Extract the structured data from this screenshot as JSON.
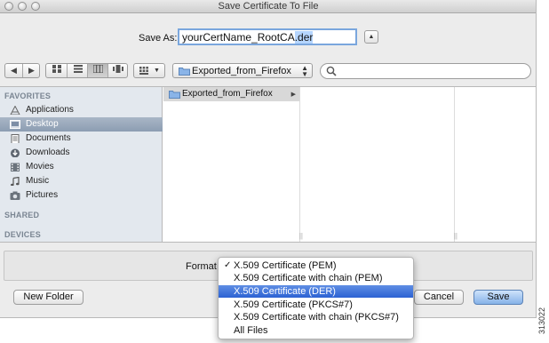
{
  "window": {
    "title": "Save Certificate To File"
  },
  "save_as": {
    "label": "Save As:",
    "filename_base": "yourCertName_RootCA",
    "filename_ext": ".der"
  },
  "location": {
    "current_folder": "Exported_from_Firefox",
    "search_value": ""
  },
  "sidebar": {
    "favorites_header": "FAVORITES",
    "items": [
      {
        "label": "Applications",
        "icon": "applications-icon",
        "selected": false
      },
      {
        "label": "Desktop",
        "icon": "desktop-icon",
        "selected": true
      },
      {
        "label": "Documents",
        "icon": "documents-icon",
        "selected": false
      },
      {
        "label": "Downloads",
        "icon": "downloads-icon",
        "selected": false
      },
      {
        "label": "Movies",
        "icon": "movies-icon",
        "selected": false
      },
      {
        "label": "Music",
        "icon": "music-icon",
        "selected": false
      },
      {
        "label": "Pictures",
        "icon": "pictures-icon",
        "selected": false
      }
    ],
    "shared_header": "SHARED",
    "devices_header": "DEVICES"
  },
  "columns": {
    "first_item": "Exported_from_Firefox"
  },
  "format": {
    "label": "Format",
    "selected_index": 2,
    "options": [
      "X.509 Certificate (PEM)",
      "X.509 Certificate with chain (PEM)",
      "X.509 Certificate (DER)",
      "X.509 Certificate (PKCS#7)",
      "X.509 Certificate with chain (PKCS#7)",
      "All Files"
    ]
  },
  "buttons": {
    "new_folder": "New Folder",
    "cancel": "Cancel",
    "save": "Save"
  },
  "figure_id": "313022",
  "colors": {
    "selection": "#2c62d3",
    "sidebar_bg": "#e3e8ee",
    "default_button": "#86b2e8"
  }
}
